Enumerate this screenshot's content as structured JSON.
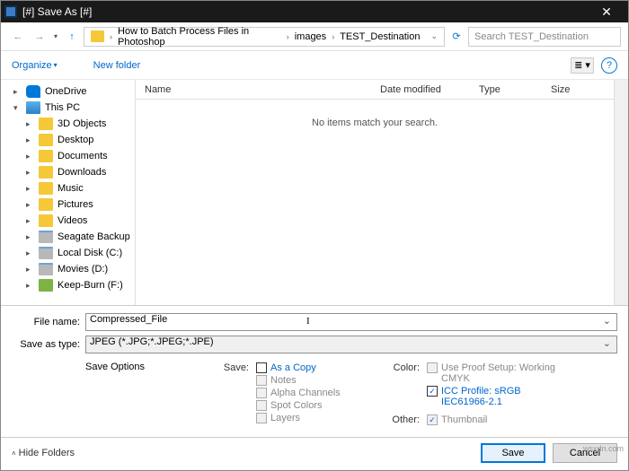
{
  "titlebar": {
    "title": "[#] Save As [#]"
  },
  "address": {
    "crumbs": [
      "How to Batch Process Files in Photoshop",
      "images",
      "TEST_Destination"
    ],
    "search_placeholder": "Search TEST_Destination"
  },
  "toolbar": {
    "organize": "Organize",
    "new_folder": "New folder"
  },
  "tree": {
    "items": [
      {
        "label": "OneDrive",
        "icon": "onedrive",
        "level": 1
      },
      {
        "label": "This PC",
        "icon": "pc",
        "level": 1,
        "exp": "▾"
      },
      {
        "label": "3D Objects",
        "icon": "folder",
        "level": 2
      },
      {
        "label": "Desktop",
        "icon": "folder",
        "level": 2
      },
      {
        "label": "Documents",
        "icon": "folder",
        "level": 2
      },
      {
        "label": "Downloads",
        "icon": "folder",
        "level": 2
      },
      {
        "label": "Music",
        "icon": "folder",
        "level": 2
      },
      {
        "label": "Pictures",
        "icon": "folder",
        "level": 2
      },
      {
        "label": "Videos",
        "icon": "folder",
        "level": 2
      },
      {
        "label": "Seagate Backup",
        "icon": "disk",
        "level": 2
      },
      {
        "label": "Local Disk (C:)",
        "icon": "disk",
        "level": 2
      },
      {
        "label": "Movies (D:)",
        "icon": "disk",
        "level": 2
      },
      {
        "label": "Keep-Burn (F:)",
        "icon": "net",
        "level": 2
      }
    ]
  },
  "columns": {
    "name": "Name",
    "date": "Date modified",
    "type": "Type",
    "size": "Size"
  },
  "empty": "No items match your search.",
  "fields": {
    "file_name_label": "File name:",
    "file_name_value": "Compressed_File",
    "type_label": "Save as type:",
    "type_value": "JPEG (*.JPG;*.JPEG;*.JPE)"
  },
  "save_options": {
    "title": "Save Options",
    "save_label": "Save:",
    "as_copy": "As a Copy",
    "notes": "Notes",
    "alpha": "Alpha Channels",
    "spot": "Spot Colors",
    "layers": "Layers",
    "color_label": "Color:",
    "proof": "Use Proof Setup: Working CMYK",
    "icc": "ICC Profile:  sRGB IEC61966-2.1",
    "other_label": "Other:",
    "thumbnail": "Thumbnail"
  },
  "footer": {
    "hide": "Hide Folders",
    "save": "Save",
    "cancel": "Cancel"
  },
  "watermark": "wsxdn.com"
}
